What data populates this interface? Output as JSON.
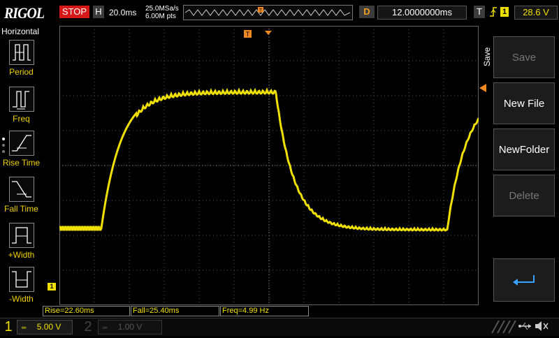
{
  "brand": "RIGOL",
  "run_status": "STOP",
  "horizontal": {
    "mode_label": "H",
    "timebase": "20.0ms",
    "sample_rate": "25.0MSa/s",
    "mem_depth": "6.00M pts"
  },
  "delay": {
    "label": "D",
    "value": "12.0000000ms"
  },
  "trigger": {
    "label": "T",
    "source": "1",
    "level": "28.6 V"
  },
  "left_menu": {
    "title": "Horizontal",
    "items": [
      {
        "label": "Period"
      },
      {
        "label": "Freq"
      },
      {
        "label": "Rise Time"
      },
      {
        "label": "Fall Time"
      },
      {
        "label": "+Width"
      },
      {
        "label": "-Width"
      }
    ]
  },
  "right_menu": {
    "title": "Save",
    "buttons": [
      {
        "label": "Save",
        "enabled": false
      },
      {
        "label": "New File",
        "enabled": true
      },
      {
        "label": "NewFolder",
        "enabled": true
      },
      {
        "label": "Delete",
        "enabled": false
      }
    ]
  },
  "measurements": [
    {
      "text": "Rise=22.60ms"
    },
    {
      "text": "Fall=25.40ms"
    },
    {
      "text": "Freq=4.99 Hz"
    }
  ],
  "channels": [
    {
      "num": "1",
      "scale": "5.00 V",
      "active": true
    },
    {
      "num": "2",
      "scale": "1.00 V",
      "active": false
    }
  ],
  "ch1_marker": "1",
  "trigger_marker": "T",
  "colors": {
    "ch1": "#f0e000",
    "trigger": "#f08a20",
    "stop": "#d71818"
  }
}
